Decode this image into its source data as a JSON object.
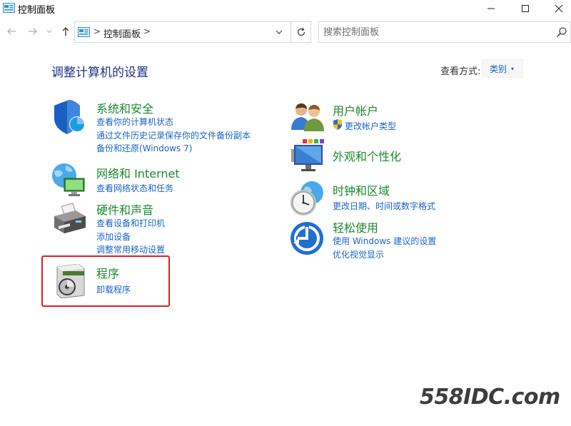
{
  "window": {
    "title": "控制面板",
    "app_icon": "control-panel-icon",
    "controls": [
      "minimize-icon",
      "maximize-icon",
      "close-icon"
    ]
  },
  "nav": {
    "back_icon": "arrow-left-icon",
    "forward_icon": "arrow-right-icon",
    "recent_icon": "chevron-down-icon",
    "up_icon": "arrow-up-icon",
    "address": {
      "icon": "control-panel-icon",
      "path": "控制面板",
      "separator": ">",
      "dropdown_icon": "chevron-down-icon",
      "refresh_icon": "refresh-icon"
    },
    "search": {
      "placeholder": "搜索控制面板",
      "icon": "search-icon"
    }
  },
  "main": {
    "title": "调整计算机的设置",
    "view_by": {
      "label": "查看方式:",
      "value": "类别",
      "caret": "▾"
    },
    "left_categories": [
      {
        "title": "系统和安全",
        "icon": "shield-icon",
        "links": [
          "查看你的计算机状态",
          "通过文件历史记录保存你的文件备份副本",
          "备份和还原(Windows 7)"
        ]
      },
      {
        "title": "网络和 Internet",
        "icon": "network-globe-icon",
        "links": [
          "查看网络状态和任务"
        ]
      },
      {
        "title": "硬件和声音",
        "icon": "printer-icon",
        "links": [
          "查看设备和打印机",
          "添加设备",
          "调整常用移动设置"
        ]
      },
      {
        "title": "程序",
        "icon": "programs-disc-icon",
        "links": [
          "卸载程序"
        ]
      }
    ],
    "right_categories": [
      {
        "title": "用户帐户",
        "icon": "users-icon",
        "links": [
          "更改帐户类型"
        ],
        "link_icon": "uac-shield-icon"
      },
      {
        "title": "外观和个性化",
        "icon": "monitor-palette-icon",
        "links": []
      },
      {
        "title": "时钟和区域",
        "icon": "clock-globe-icon",
        "links": [
          "更改日期、时间或数字格式"
        ]
      },
      {
        "title": "轻松使用",
        "icon": "ease-of-access-icon",
        "links": [
          "使用 Windows 建议的设置",
          "优化视觉显示"
        ]
      }
    ]
  },
  "colors": {
    "category_title": "#1a8a2c",
    "link": "#1a64c8",
    "heading": "#1e3287",
    "highlight": "#e02020"
  },
  "watermark": "558IDC.com"
}
